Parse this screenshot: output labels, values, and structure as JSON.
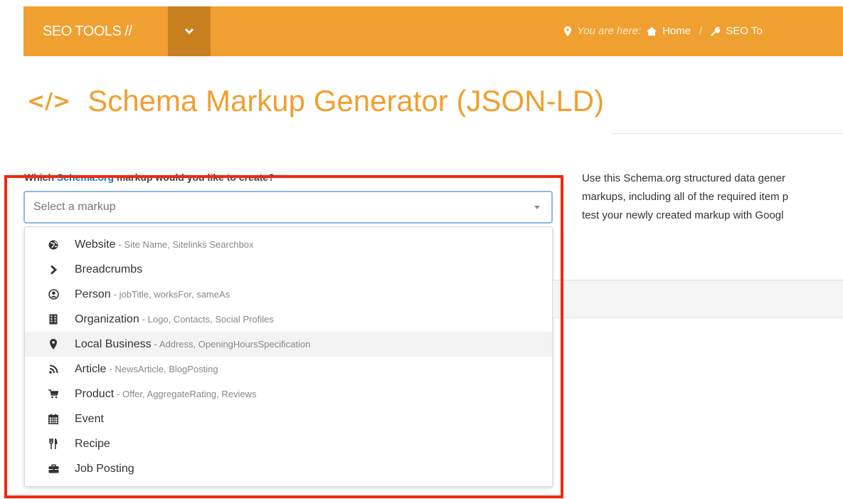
{
  "nav": {
    "brand": "SEO TOOLS //",
    "breadcrumb": {
      "you_are_here": "You are here:",
      "home": "Home",
      "separator": "/",
      "current": "SEO To"
    }
  },
  "page": {
    "title": "Schema Markup Generator (JSON-LD)",
    "question_prefix": "Which",
    "question_link": "Schema.org",
    "question_suffix": "markup would you like to create?"
  },
  "select": {
    "placeholder": "Select a markup"
  },
  "options": [
    {
      "icon": "globe-icon",
      "label": "Website",
      "desc": "- Site Name, Sitelinks Searchbox"
    },
    {
      "icon": "chevron-right-icon",
      "label": "Breadcrumbs",
      "desc": ""
    },
    {
      "icon": "user-circle-icon",
      "label": "Person",
      "desc": "- jobTitle, worksFor, sameAs"
    },
    {
      "icon": "building-icon",
      "label": "Organization",
      "desc": "- Logo, Contacts, Social Profiles"
    },
    {
      "icon": "map-marker-icon",
      "label": "Local Business",
      "desc": "- Address, OpeningHoursSpecification"
    },
    {
      "icon": "rss-icon",
      "label": "Article",
      "desc": "- NewsArticle, BlogPosting"
    },
    {
      "icon": "shopping-cart-icon",
      "label": "Product",
      "desc": "- Offer, AggregateRating, Reviews"
    },
    {
      "icon": "calendar-icon",
      "label": "Event",
      "desc": ""
    },
    {
      "icon": "utensils-icon",
      "label": "Recipe",
      "desc": ""
    },
    {
      "icon": "briefcase-icon",
      "label": "Job Posting",
      "desc": ""
    }
  ],
  "description": {
    "line1": "Use this Schema.org structured data gener",
    "line2": "markups, including all of the required item p",
    "line3": "test your newly created markup with Googl"
  },
  "colors": {
    "brand": "#f0a030",
    "brand_dark": "#c8801e",
    "highlight": "#f02a0e",
    "link": "#1f6fb8"
  }
}
